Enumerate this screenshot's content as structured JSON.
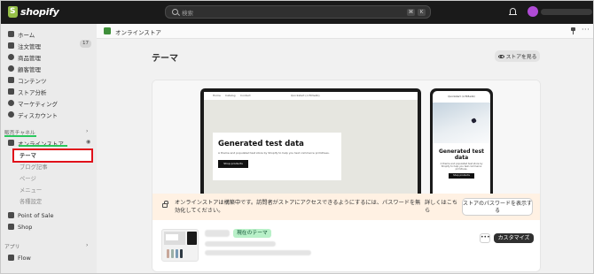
{
  "topbar": {
    "brand": "shopify",
    "search_placeholder": "検索",
    "shortcut_keys": [
      "⌘",
      "K"
    ]
  },
  "sidebar": {
    "items": [
      {
        "label": "ホーム",
        "icon": "home-icon"
      },
      {
        "label": "注文管理",
        "icon": "orders-icon",
        "badge": "17"
      },
      {
        "label": "商品管理",
        "icon": "tag-icon"
      },
      {
        "label": "顧客管理",
        "icon": "person-icon"
      },
      {
        "label": "コンテンツ",
        "icon": "content-icon"
      },
      {
        "label": "ストア分析",
        "icon": "chart-icon"
      },
      {
        "label": "マーケティング",
        "icon": "target-icon"
      },
      {
        "label": "ディスカウント",
        "icon": "discount-icon"
      }
    ],
    "sales_channels_heading": "販売チャネル",
    "online_store": "オンラインストア",
    "online_store_sub": [
      "テーマ",
      "ブログ記事",
      "ページ",
      "メニュー",
      "各種設定"
    ],
    "channels": [
      {
        "label": "Point of Sale",
        "icon": "pos-icon"
      },
      {
        "label": "Shop",
        "icon": "shop-icon"
      }
    ],
    "apps_heading": "アプリ",
    "apps": [
      {
        "label": "Flow",
        "icon": "flow-icon"
      }
    ]
  },
  "breadcrumb": {
    "label": "オンラインストア"
  },
  "page": {
    "title": "テーマ",
    "view_store_label": "ストアを見る"
  },
  "preview": {
    "desktop_nav": [
      "Home",
      "Catalog",
      "Contact"
    ],
    "desktop_brand": "Quickstart (ccf03e4b)",
    "hero_title": "Generated test data",
    "hero_desc": "A theme and populated test store by Shopify to help you test commerce primitives.",
    "hero_button": "Shop products",
    "mobile_brand": "Quickstart (ccf03e4b)",
    "mobile_title": "Generated test data",
    "mobile_desc": "A theme and populated test store by Shopify to help you test commerce primitives.",
    "mobile_button": "Shop products"
  },
  "banner": {
    "text": "オンラインストアは構築中です。訪問者がストアにアクセスできるようにするには、パスワードを無効化してください。",
    "link": "詳しくはこちら",
    "password_button": "ストアのパスワードを表示する"
  },
  "theme": {
    "current_badge": "現在のテーマ",
    "more_label": "•••",
    "customize_label": "カスタマイズ"
  },
  "colors": {
    "topbar": "#1a1a1a",
    "sidebar": "#ebebeb",
    "highlight_green": "#2ac85e",
    "annotation_red": "#e0101a",
    "banner_bg": "#fff1e3",
    "badge_green": "#b8f0c8"
  }
}
